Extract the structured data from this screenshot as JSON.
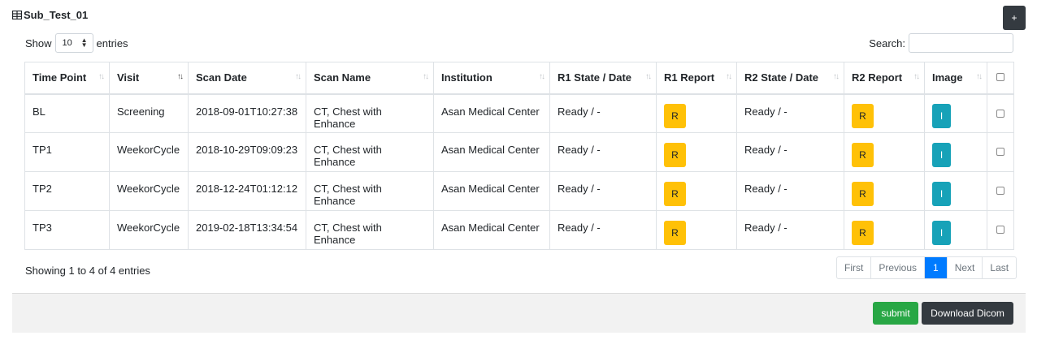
{
  "header": {
    "title": "Sub_Test_01",
    "title_icon": "table-icon",
    "add_label": "+"
  },
  "controls": {
    "show_label": "Show",
    "length_value": "10",
    "entries_label": "entries",
    "search_label": "Search:",
    "search_value": ""
  },
  "table": {
    "columns": [
      {
        "label": "Time Point",
        "sort": "none"
      },
      {
        "label": "Visit",
        "sort": "active"
      },
      {
        "label": "Scan Date",
        "sort": "none"
      },
      {
        "label": "Scan Name",
        "sort": "none"
      },
      {
        "label": "Institution",
        "sort": "none"
      },
      {
        "label": "R1 State / Date",
        "sort": "none"
      },
      {
        "label": "R1 Report",
        "sort": "none"
      },
      {
        "label": "R2 State / Date",
        "sort": "none"
      },
      {
        "label": "R2 Report",
        "sort": "none"
      },
      {
        "label": "Image",
        "sort": "none"
      }
    ],
    "rows": [
      {
        "time_point": "BL",
        "visit": "Screening",
        "scan_date": "2018-09-01T10:27:38",
        "scan_name": "CT, Chest with Enhance",
        "institution": "Asan Medical Center",
        "r1_state": "Ready / -",
        "r1_report": "R",
        "r2_state": "Ready / -",
        "r2_report": "R",
        "image": "I"
      },
      {
        "time_point": "TP1",
        "visit": "WeekorCycle",
        "scan_date": "2018-10-29T09:09:23",
        "scan_name": "CT, Chest with Enhance",
        "institution": "Asan Medical Center",
        "r1_state": "Ready / -",
        "r1_report": "R",
        "r2_state": "Ready / -",
        "r2_report": "R",
        "image": "I"
      },
      {
        "time_point": "TP2",
        "visit": "WeekorCycle",
        "scan_date": "2018-12-24T01:12:12",
        "scan_name": "CT, Chest with Enhance",
        "institution": "Asan Medical Center",
        "r1_state": "Ready / -",
        "r1_report": "R",
        "r2_state": "Ready / -",
        "r2_report": "R",
        "image": "I"
      },
      {
        "time_point": "TP3",
        "visit": "WeekorCycle",
        "scan_date": "2019-02-18T13:34:54",
        "scan_name": "CT, Chest with Enhance",
        "institution": "Asan Medical Center",
        "r1_state": "Ready / -",
        "r1_report": "R",
        "r2_state": "Ready / -",
        "r2_report": "R",
        "image": "I"
      }
    ]
  },
  "info": "Showing 1 to 4 of 4 entries",
  "pagination": {
    "first": "First",
    "previous": "Previous",
    "current": "1",
    "next": "Next",
    "last": "Last"
  },
  "footer": {
    "submit_label": "submit",
    "download_label": "Download Dicom"
  },
  "colors": {
    "report_button": "#ffc107",
    "image_button": "#17a2b8",
    "submit_button": "#28a745",
    "dark_button": "#343a40",
    "active_page": "#007bff"
  }
}
